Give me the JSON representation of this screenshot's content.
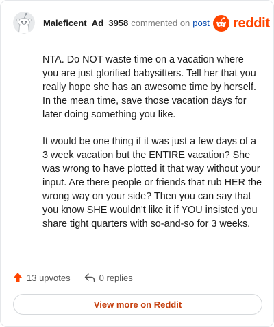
{
  "comment": {
    "username": "Maleficent_Ad_3958",
    "action_text": "commented on",
    "post_link": "post",
    "paragraphs": [
      "NTA. Do NOT waste time on a vacation where you are just glorified babysitters. Tell her that you really hope she has an awesome time by herself. In the mean time, save those vacation days for later doing something you like.",
      "It would be one thing if it was just a few days of a 3 week vacation but the ENTIRE vacation? She was wrong to have plotted it that way without your input. Are there people or friends that rub HER the wrong way on your side? Then you can say that you know SHE wouldn't like it if YOU insisted you share tight quarters with so-and-so for 3 weeks."
    ]
  },
  "brand": {
    "name": "reddit",
    "color": "#ff4500"
  },
  "actions": {
    "upvotes_label": "13 upvotes",
    "replies_label": "0 replies",
    "upvote_icon": "arrow-up-icon",
    "reply_icon": "reply-arrow-icon"
  },
  "footer": {
    "view_more_label": "View more on Reddit",
    "accent": "#c53d0b"
  }
}
